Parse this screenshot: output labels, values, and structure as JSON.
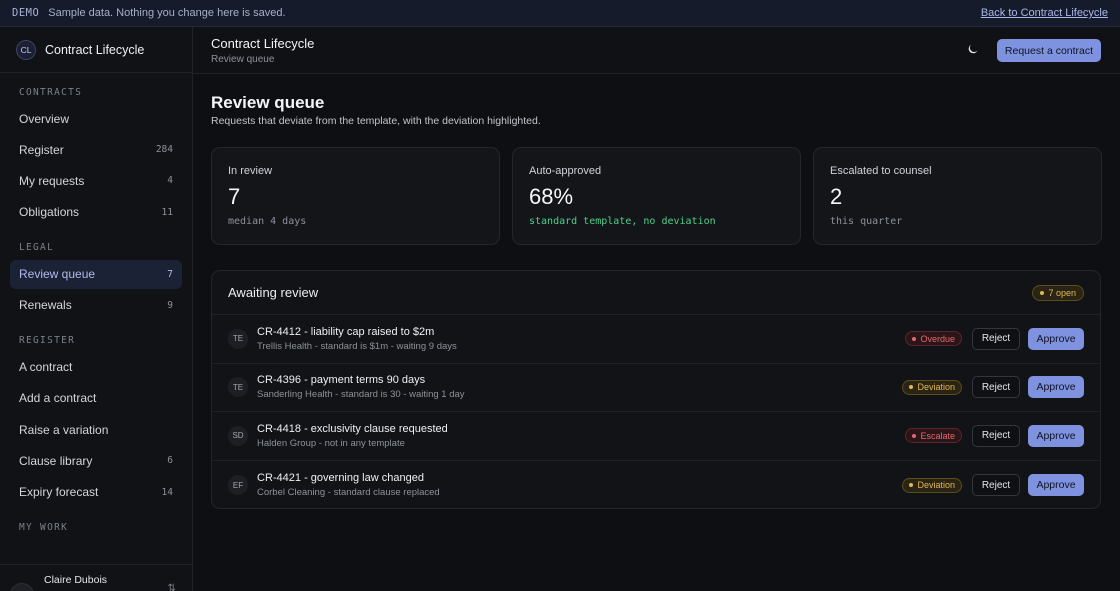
{
  "banner": {
    "tag": "DEMO",
    "message": "Sample data. Nothing you change here is saved.",
    "back_link": "Back to Contract Lifecycle"
  },
  "app": {
    "logo": "CL",
    "name": "Contract Lifecycle"
  },
  "sidebar": {
    "sections": [
      {
        "label": "CONTRACTS",
        "items": [
          {
            "label": "Overview",
            "count": ""
          },
          {
            "label": "Register",
            "count": "284"
          },
          {
            "label": "My requests",
            "count": "4"
          },
          {
            "label": "Obligations",
            "count": "11"
          }
        ]
      },
      {
        "label": "LEGAL",
        "items": [
          {
            "label": "Review queue",
            "count": "7"
          },
          {
            "label": "Renewals",
            "count": "9"
          }
        ]
      },
      {
        "label": "REGISTER",
        "items": [
          {
            "label": "A contract",
            "count": ""
          },
          {
            "label": "Add a contract",
            "count": ""
          },
          {
            "label": "Raise a variation",
            "count": ""
          },
          {
            "label": "Clause library",
            "count": "6"
          },
          {
            "label": "Expiry forecast",
            "count": "14"
          }
        ]
      },
      {
        "label": "MY WORK",
        "items": []
      }
    ],
    "user": {
      "initials": "CD",
      "name": "Claire Dubois"
    }
  },
  "topbar": {
    "title": "Contract Lifecycle",
    "subtitle": "Review queue",
    "theme_icon": "moon-icon",
    "request_button": "Request a contract"
  },
  "page": {
    "title": "Review queue",
    "subtitle": "Requests that deviate from the template, with the deviation highlighted."
  },
  "stats": [
    {
      "label": "In review",
      "value": "7",
      "note": "median 4 days"
    },
    {
      "label": "Auto-approved",
      "value": "68%",
      "note": "standard template, no deviation"
    },
    {
      "label": "Escalated to counsel",
      "value": "2",
      "note": "this quarter"
    }
  ],
  "review": {
    "title": "Awaiting review",
    "open_badge": "7 open",
    "reject_label": "Reject",
    "approve_label": "Approve",
    "rows": [
      {
        "initials": "TE",
        "title": "CR-4412 - liability cap raised to $2m",
        "sub": "Trellis Health - standard is $1m - waiting 9 days",
        "status": "Overdue",
        "tone": "red"
      },
      {
        "initials": "TE",
        "title": "CR-4396 - payment terms 90 days",
        "sub": "Sanderling Health - standard is 30 - waiting 1 day",
        "status": "Deviation",
        "tone": "amber"
      },
      {
        "initials": "SD",
        "title": "CR-4418 - exclusivity clause requested",
        "sub": "Halden Group - not in any template",
        "status": "Escalate",
        "tone": "red"
      },
      {
        "initials": "EF",
        "title": "CR-4421 - governing law changed",
        "sub": "Corbel Cleaning - standard clause replaced",
        "status": "Deviation",
        "tone": "amber"
      }
    ]
  },
  "colors": {
    "accent": "#7e92df",
    "success": "#4fd08b",
    "danger": "#e06a6f",
    "warning": "#e3b753"
  }
}
